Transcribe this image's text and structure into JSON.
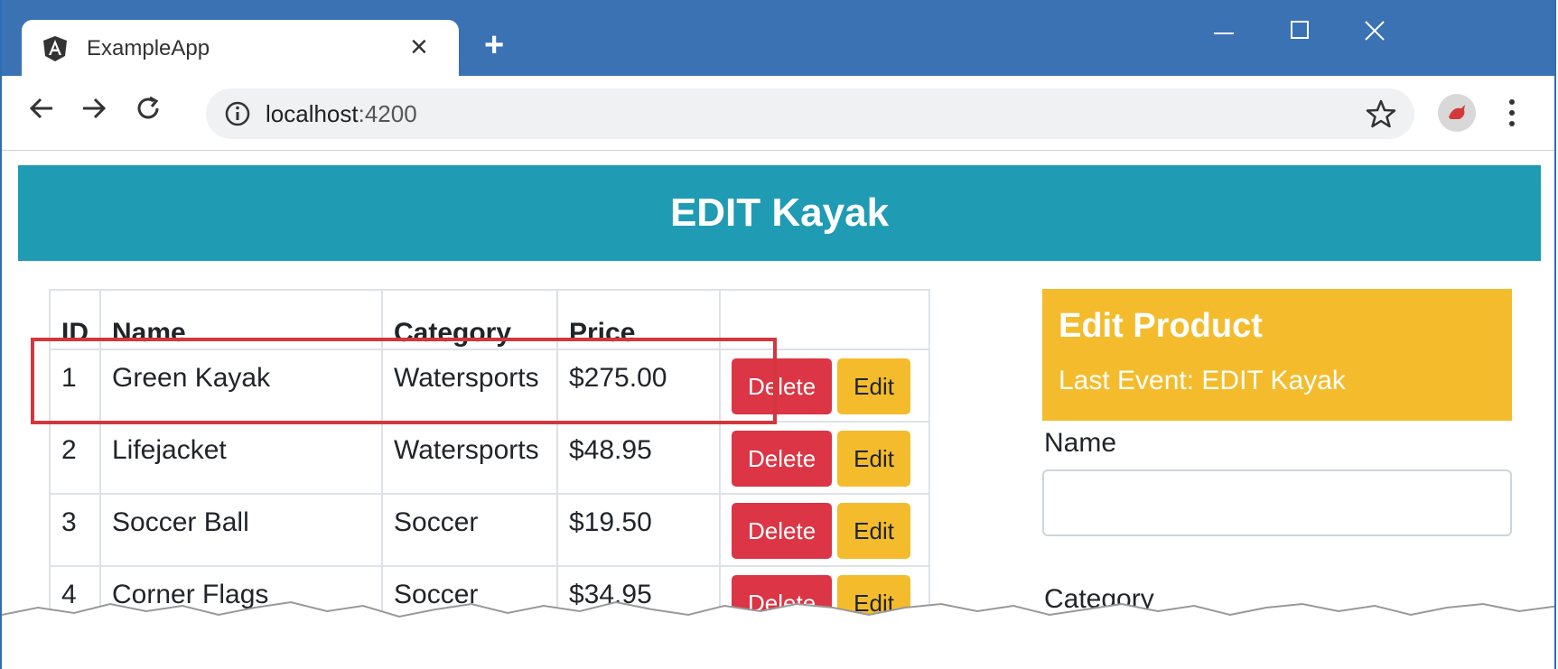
{
  "browser": {
    "tab": {
      "title": "ExampleApp"
    },
    "address": {
      "host": "localhost",
      "port": ":4200"
    }
  },
  "page": {
    "banner": "EDIT Kayak",
    "table": {
      "headers": [
        "ID",
        "Name",
        "Category",
        "Price",
        ""
      ],
      "rows": [
        {
          "id": "1",
          "name": "Green Kayak",
          "category": "Watersports",
          "price": "$275.00"
        },
        {
          "id": "2",
          "name": "Lifejacket",
          "category": "Watersports",
          "price": "$48.95"
        },
        {
          "id": "3",
          "name": "Soccer Ball",
          "category": "Soccer",
          "price": "$19.50"
        },
        {
          "id": "4",
          "name": "Corner Flags",
          "category": "Soccer",
          "price": "$34.95"
        }
      ],
      "delete_label": "Delete",
      "edit_label": "Edit"
    },
    "edit_panel": {
      "title": "Edit Product",
      "last_event": "Last Event: EDIT Kayak",
      "name_label": "Name",
      "name_value": "",
      "category_label": "Category"
    }
  },
  "colors": {
    "titlebar": "#3a72b4",
    "banner": "#1f9bb3",
    "danger": "#dc3545",
    "warning": "#f4bc2c",
    "highlight": "#d4363d"
  }
}
